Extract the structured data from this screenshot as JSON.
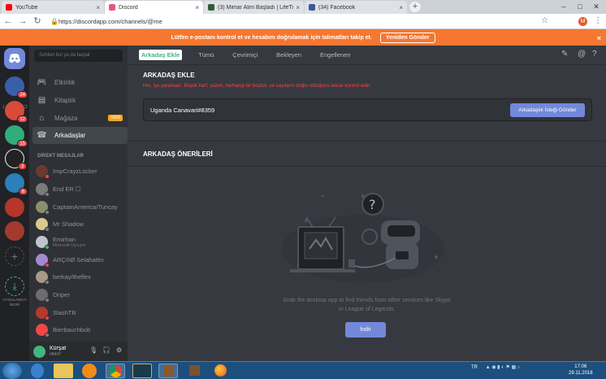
{
  "browser": {
    "tabs": [
      {
        "title": "YouTube",
        "color": "#ff0000"
      },
      {
        "title": "Discord",
        "color": "#e8567b"
      },
      {
        "title": "(3) Mimar Alim Başladı | LifeTi...",
        "color": "#2e5b3a"
      },
      {
        "title": "(34) Facebook",
        "color": "#3b5998"
      }
    ],
    "url": "https://discordapp.com/channels/@me",
    "profile_initial": "M"
  },
  "banner": {
    "text": "Lütfen e-postanı kontrol et ve hesabını doğrulamak için talimatları takip et.",
    "button": "Yeniden Gönder"
  },
  "guilds": {
    "online_label": "1 ÇEVRİMİÇİ",
    "download_label": "UYGULAMAYI İNDİR",
    "servers": [
      {
        "badge": "24",
        "color": "#3a5fa8"
      },
      {
        "badge": "12",
        "color": "#d84a3a"
      },
      {
        "badge": "15",
        "color": "#2fae7b"
      },
      {
        "badge": "3",
        "color": "#222"
      },
      {
        "badge": "6",
        "color": "#2c7fb8"
      },
      {
        "badge": "",
        "color": "#b5362a"
      },
      {
        "badge": "",
        "color": "#a33a2e"
      }
    ]
  },
  "sidebar": {
    "search_placeholder": "Sohbet bul ya da başlat",
    "nav": [
      {
        "label": "Etkinlik",
        "icon": "gamepad-icon"
      },
      {
        "label": "Kitaplık",
        "icon": "library-icon"
      },
      {
        "label": "Mağaza",
        "icon": "store-icon",
        "tag": "YENİ"
      },
      {
        "label": "Arkadaşlar",
        "icon": "friends-icon"
      }
    ],
    "dm_header": "DİREKT MESAJLAR",
    "dms": [
      {
        "name": "ImpCrayzLocker",
        "sub": "",
        "color": "#6b3a2e",
        "status": "#f04747"
      },
      {
        "name": "End ER ☐",
        "sub": "",
        "color": "#7b7b7b",
        "status": "#747f8d"
      },
      {
        "name": "CaptainAmerica/Tuncay",
        "sub": "",
        "color": "#8a8f6a",
        "status": "#747f8d"
      },
      {
        "name": "Mr Shadow",
        "sub": "",
        "color": "#d9c98e",
        "status": "#747f8d"
      },
      {
        "name": "Emirhan",
        "sub": "Minecraft Oynuyor",
        "color": "#bfc5cc",
        "status": "#43b581"
      },
      {
        "name": "ARÇ®Ø Selahattin",
        "sub": "",
        "color": "#a28ad1",
        "status": "#f04747"
      },
      {
        "name": "berkay/theflex",
        "sub": "",
        "color": "#a79887",
        "status": "#747f8d"
      },
      {
        "name": "Oriper",
        "sub": "",
        "color": "#6d6d6d",
        "status": "#747f8d"
      },
      {
        "name": "SlashTR",
        "sub": "",
        "color": "#b53a2b",
        "status": "#f04747"
      },
      {
        "name": "Bierbauchbob",
        "sub": "",
        "color": "#f04747",
        "status": "#747f8d"
      }
    ],
    "user": {
      "name": "Kürşat",
      "tag": "#8447"
    }
  },
  "main": {
    "tabs": [
      "Arkadaş Ekle",
      "Tümü",
      "Çevrimiçi",
      "Bekleyen",
      "Engellenen"
    ],
    "add_title": "ARKADAŞ EKLE",
    "add_hint": "Hm, işe yaramadı. Büyük harf, yazım, herhangi bir boşluk, ve sayıların doğru olduğunu tekrar kontrol edin.",
    "add_value": "Uganda Canavari#8359",
    "send_label": "Arkadaşlık İsteği Gönder",
    "suggest_title": "ARKADAŞ ÖNERİLERİ",
    "grab_line1": "Grab the desktop app to find friends from other services like Skype",
    "grab_line2": "or League of Legends.",
    "download_label": "İndir"
  },
  "taskbar": {
    "lang": "TR",
    "time": "17:06",
    "date": "29.11.2018"
  }
}
